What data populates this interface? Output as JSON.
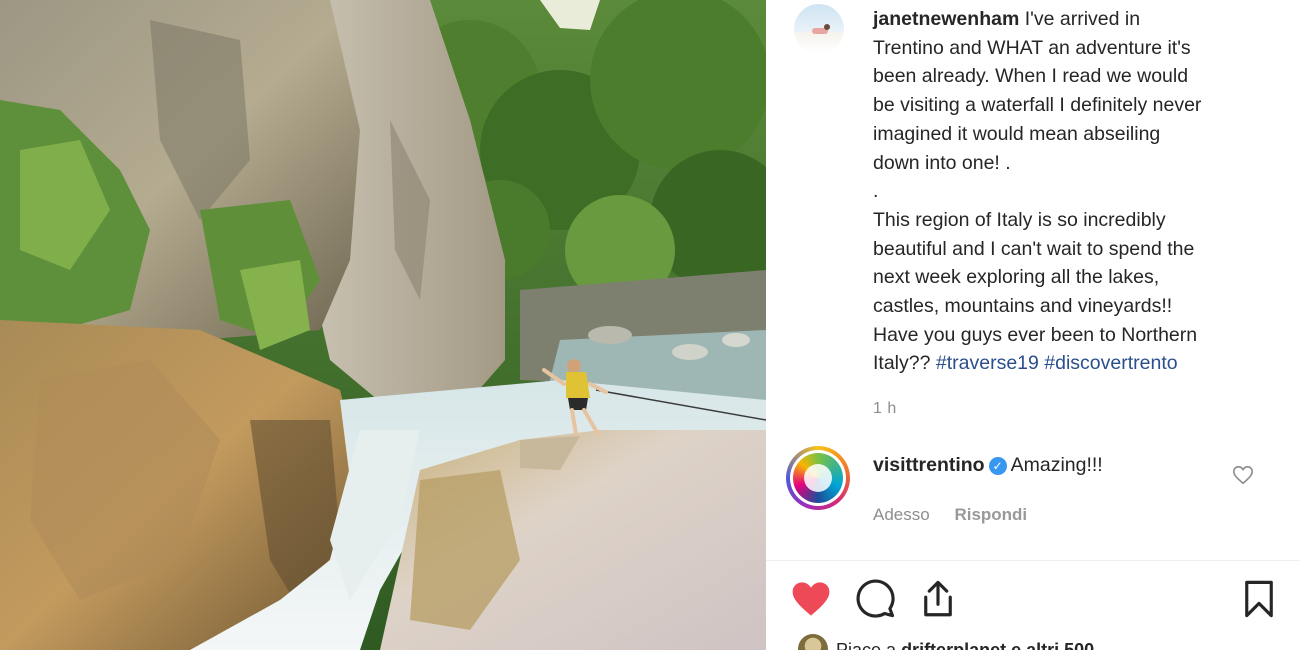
{
  "post": {
    "author": "janetnewenham",
    "caption_lines": [
      "I've arrived in",
      "Trentino and WHAT an adventure it's",
      "been already. When I read we would",
      "be visiting a waterfall I definitely never",
      "imagined it would mean abseiling",
      "down into one! .",
      ".",
      "This region of Italy is so incredibly",
      "beautiful and I can't wait to spend the",
      "next week exploring all the lakes,",
      "castles, mountains and vineyards!!",
      "Have you guys ever been to Northern"
    ],
    "caption_last_prefix": "Italy??",
    "hashtags": [
      "#traverse19",
      "#discovertrento"
    ],
    "time": "1 h"
  },
  "comment": {
    "user": "visittrentino",
    "text": "Amazing!!!",
    "time": "Adesso",
    "reply_label": "Rispondi"
  },
  "likes": {
    "prefix": "Piace a",
    "user": "drifterplanet",
    "suffix": "e altri 500"
  },
  "icons": {
    "like": "heart-filled-icon",
    "comment": "comment-bubble-icon",
    "share": "share-icon",
    "save": "bookmark-icon",
    "comment_like": "heart-outline-icon",
    "verified": "verified-badge-icon"
  },
  "colors": {
    "like_red": "#ed4956",
    "hashtag": "#2b4f8e",
    "verified": "#3897f0",
    "muted": "#8e8e8e"
  }
}
